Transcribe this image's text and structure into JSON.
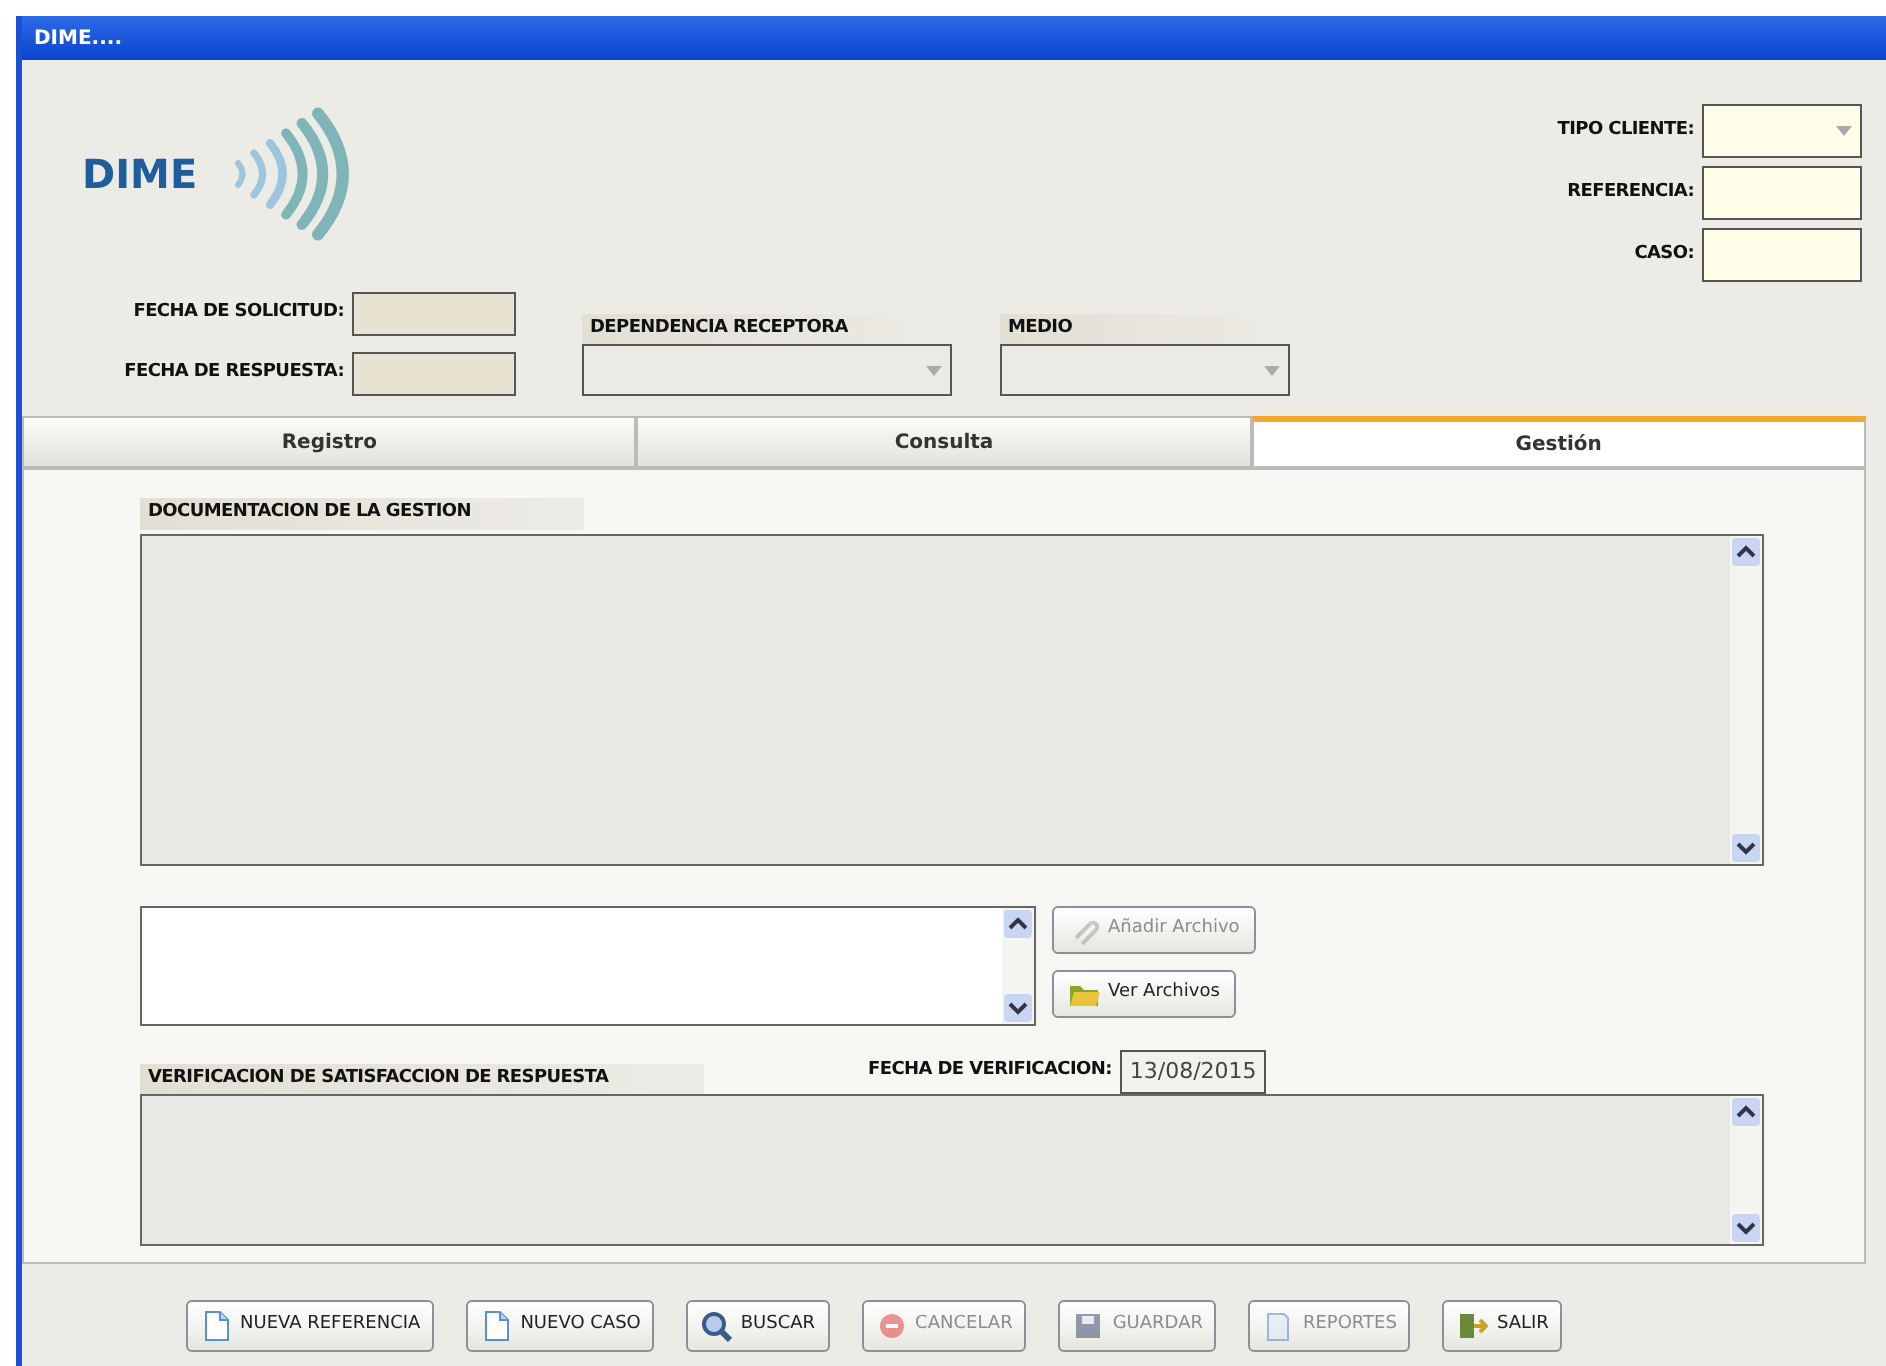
{
  "window": {
    "title": "DIME...."
  },
  "logo": {
    "text": "DIME"
  },
  "request_dates": [
    {
      "label": "FECHA DE SOLICITUD:"
    },
    {
      "label": "FECHA DE RESPUESTA:"
    }
  ],
  "selects": [
    {
      "label": "DEPENDENCIA RECEPTORA",
      "disabled": true
    },
    {
      "label": "MEDIO",
      "disabled": true
    }
  ],
  "client_fields": [
    {
      "label": "TIPO CLIENTE:",
      "kind": "select"
    },
    {
      "label": "REFERENCIA:",
      "kind": "text"
    },
    {
      "label": "CASO:",
      "kind": "text"
    }
  ],
  "tabs": [
    {
      "label": "Registro",
      "selected": false
    },
    {
      "label": "Consulta",
      "selected": false
    },
    {
      "label": "Gestión",
      "selected": true
    }
  ],
  "gestion": {
    "documentation_label": "DOCUMENTACION DE LA GESTION",
    "file_buttons": [
      {
        "label": "Añadir Archivo",
        "kind": "clip",
        "disabled": true
      },
      {
        "label": "Ver Archivos",
        "kind": "folder",
        "disabled": false
      }
    ],
    "verification_label": "VERIFICACION DE SATISFACCION DE RESPUESTA",
    "verification_date": {
      "label": "FECHA DE VERIFICACION:",
      "value": "13/08/2015"
    }
  },
  "buttons": [
    {
      "label": "NUEVA REFERENCIA",
      "kind": "page",
      "disabled": false
    },
    {
      "label": "NUEVO CASO",
      "kind": "page",
      "disabled": false
    },
    {
      "label": "BUSCAR",
      "kind": "search",
      "disabled": false
    },
    {
      "label": "CANCELAR",
      "kind": "cancel",
      "disabled": true
    },
    {
      "label": "GUARDAR",
      "kind": "disk",
      "disabled": true
    },
    {
      "label": "REPORTES",
      "kind": "report",
      "disabled": true
    },
    {
      "label": "SALIR",
      "kind": "exit",
      "disabled": false
    }
  ]
}
